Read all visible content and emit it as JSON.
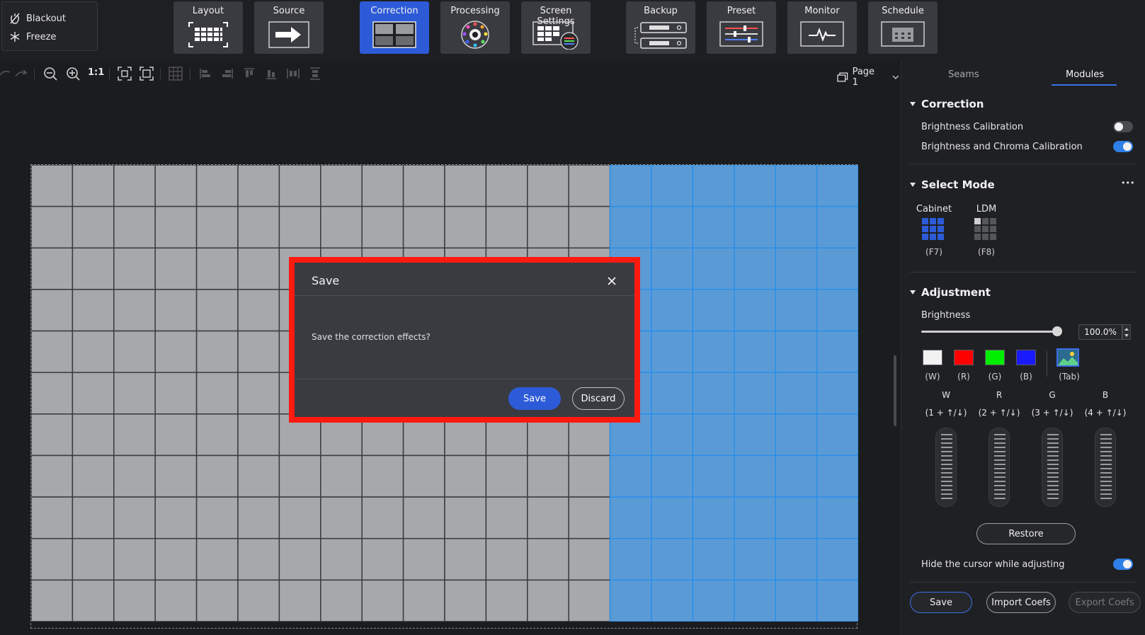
{
  "topbar": {
    "blackout_label": "Blackout",
    "freeze_label": "Freeze",
    "nav": [
      {
        "label": "Layout",
        "icon": "layout-icon"
      },
      {
        "label": "Source",
        "icon": "source-icon"
      },
      {
        "label": "Correction",
        "icon": "correction-icon",
        "active": true
      },
      {
        "label": "Processing",
        "icon": "processing-icon"
      },
      {
        "label": "Screen Settings",
        "icon": "screen-settings-icon"
      },
      {
        "label": "Backup",
        "icon": "backup-icon"
      },
      {
        "label": "Preset",
        "icon": "preset-icon"
      },
      {
        "label": "Monitor",
        "icon": "monitor-icon"
      },
      {
        "label": "Schedule",
        "icon": "schedule-icon"
      }
    ]
  },
  "toolbar": {
    "zoom_1to1_label": "1:1",
    "page_label": "Page 1"
  },
  "canvas": {
    "grid_rows": 11,
    "grid_cols": 20,
    "selected_from_col": 14,
    "gray_color": "#a7a8ab",
    "selected_color": "#5b9bd5",
    "selected_line_color": "#2a8fe8"
  },
  "dialog": {
    "title": "Save",
    "message": "Save the correction effects?",
    "save_label": "Save",
    "discard_label": "Discard"
  },
  "panel": {
    "tabs": [
      "Seams",
      "Modules"
    ],
    "active_tab": "Modules",
    "correction": {
      "heading": "Correction",
      "brightness_calibration_label": "Brightness Calibration",
      "brightness_calibration_on": false,
      "brightness_chroma_label": "Brightness and Chroma Calibration",
      "brightness_chroma_on": true
    },
    "select_mode": {
      "heading": "Select Mode",
      "more_label": "•••",
      "cabinet_label": "Cabinet",
      "cabinet_key": "(F7)",
      "ldm_label": "LDM",
      "ldm_key": "(F8)"
    },
    "adjustment": {
      "heading": "Adjustment",
      "brightness_label": "Brightness",
      "brightness_value": "100.0%",
      "brightness_fraction": 1.0,
      "swatches": [
        {
          "label": "(W)",
          "color": "#f2f2f2"
        },
        {
          "label": "(R)",
          "color": "#ff0000"
        },
        {
          "label": "(G)",
          "color": "#00ee00"
        },
        {
          "label": "(B)",
          "color": "#1a1aff"
        },
        {
          "label": "(Tab)",
          "color": "#2c6a8f"
        }
      ],
      "channels": [
        {
          "name": "W",
          "hint": "(1 + ↑/↓)"
        },
        {
          "name": "R",
          "hint": "(2 + ↑/↓)"
        },
        {
          "name": "G",
          "hint": "(3 + ↑/↓)"
        },
        {
          "name": "B",
          "hint": "(4 + ↑/↓)"
        }
      ],
      "restore_label": "Restore",
      "hide_cursor_label": "Hide the cursor while adjusting",
      "hide_cursor_on": true
    },
    "footer": {
      "save_label": "Save",
      "import_label": "Import Coefs",
      "export_label": "Export Coefs"
    }
  }
}
